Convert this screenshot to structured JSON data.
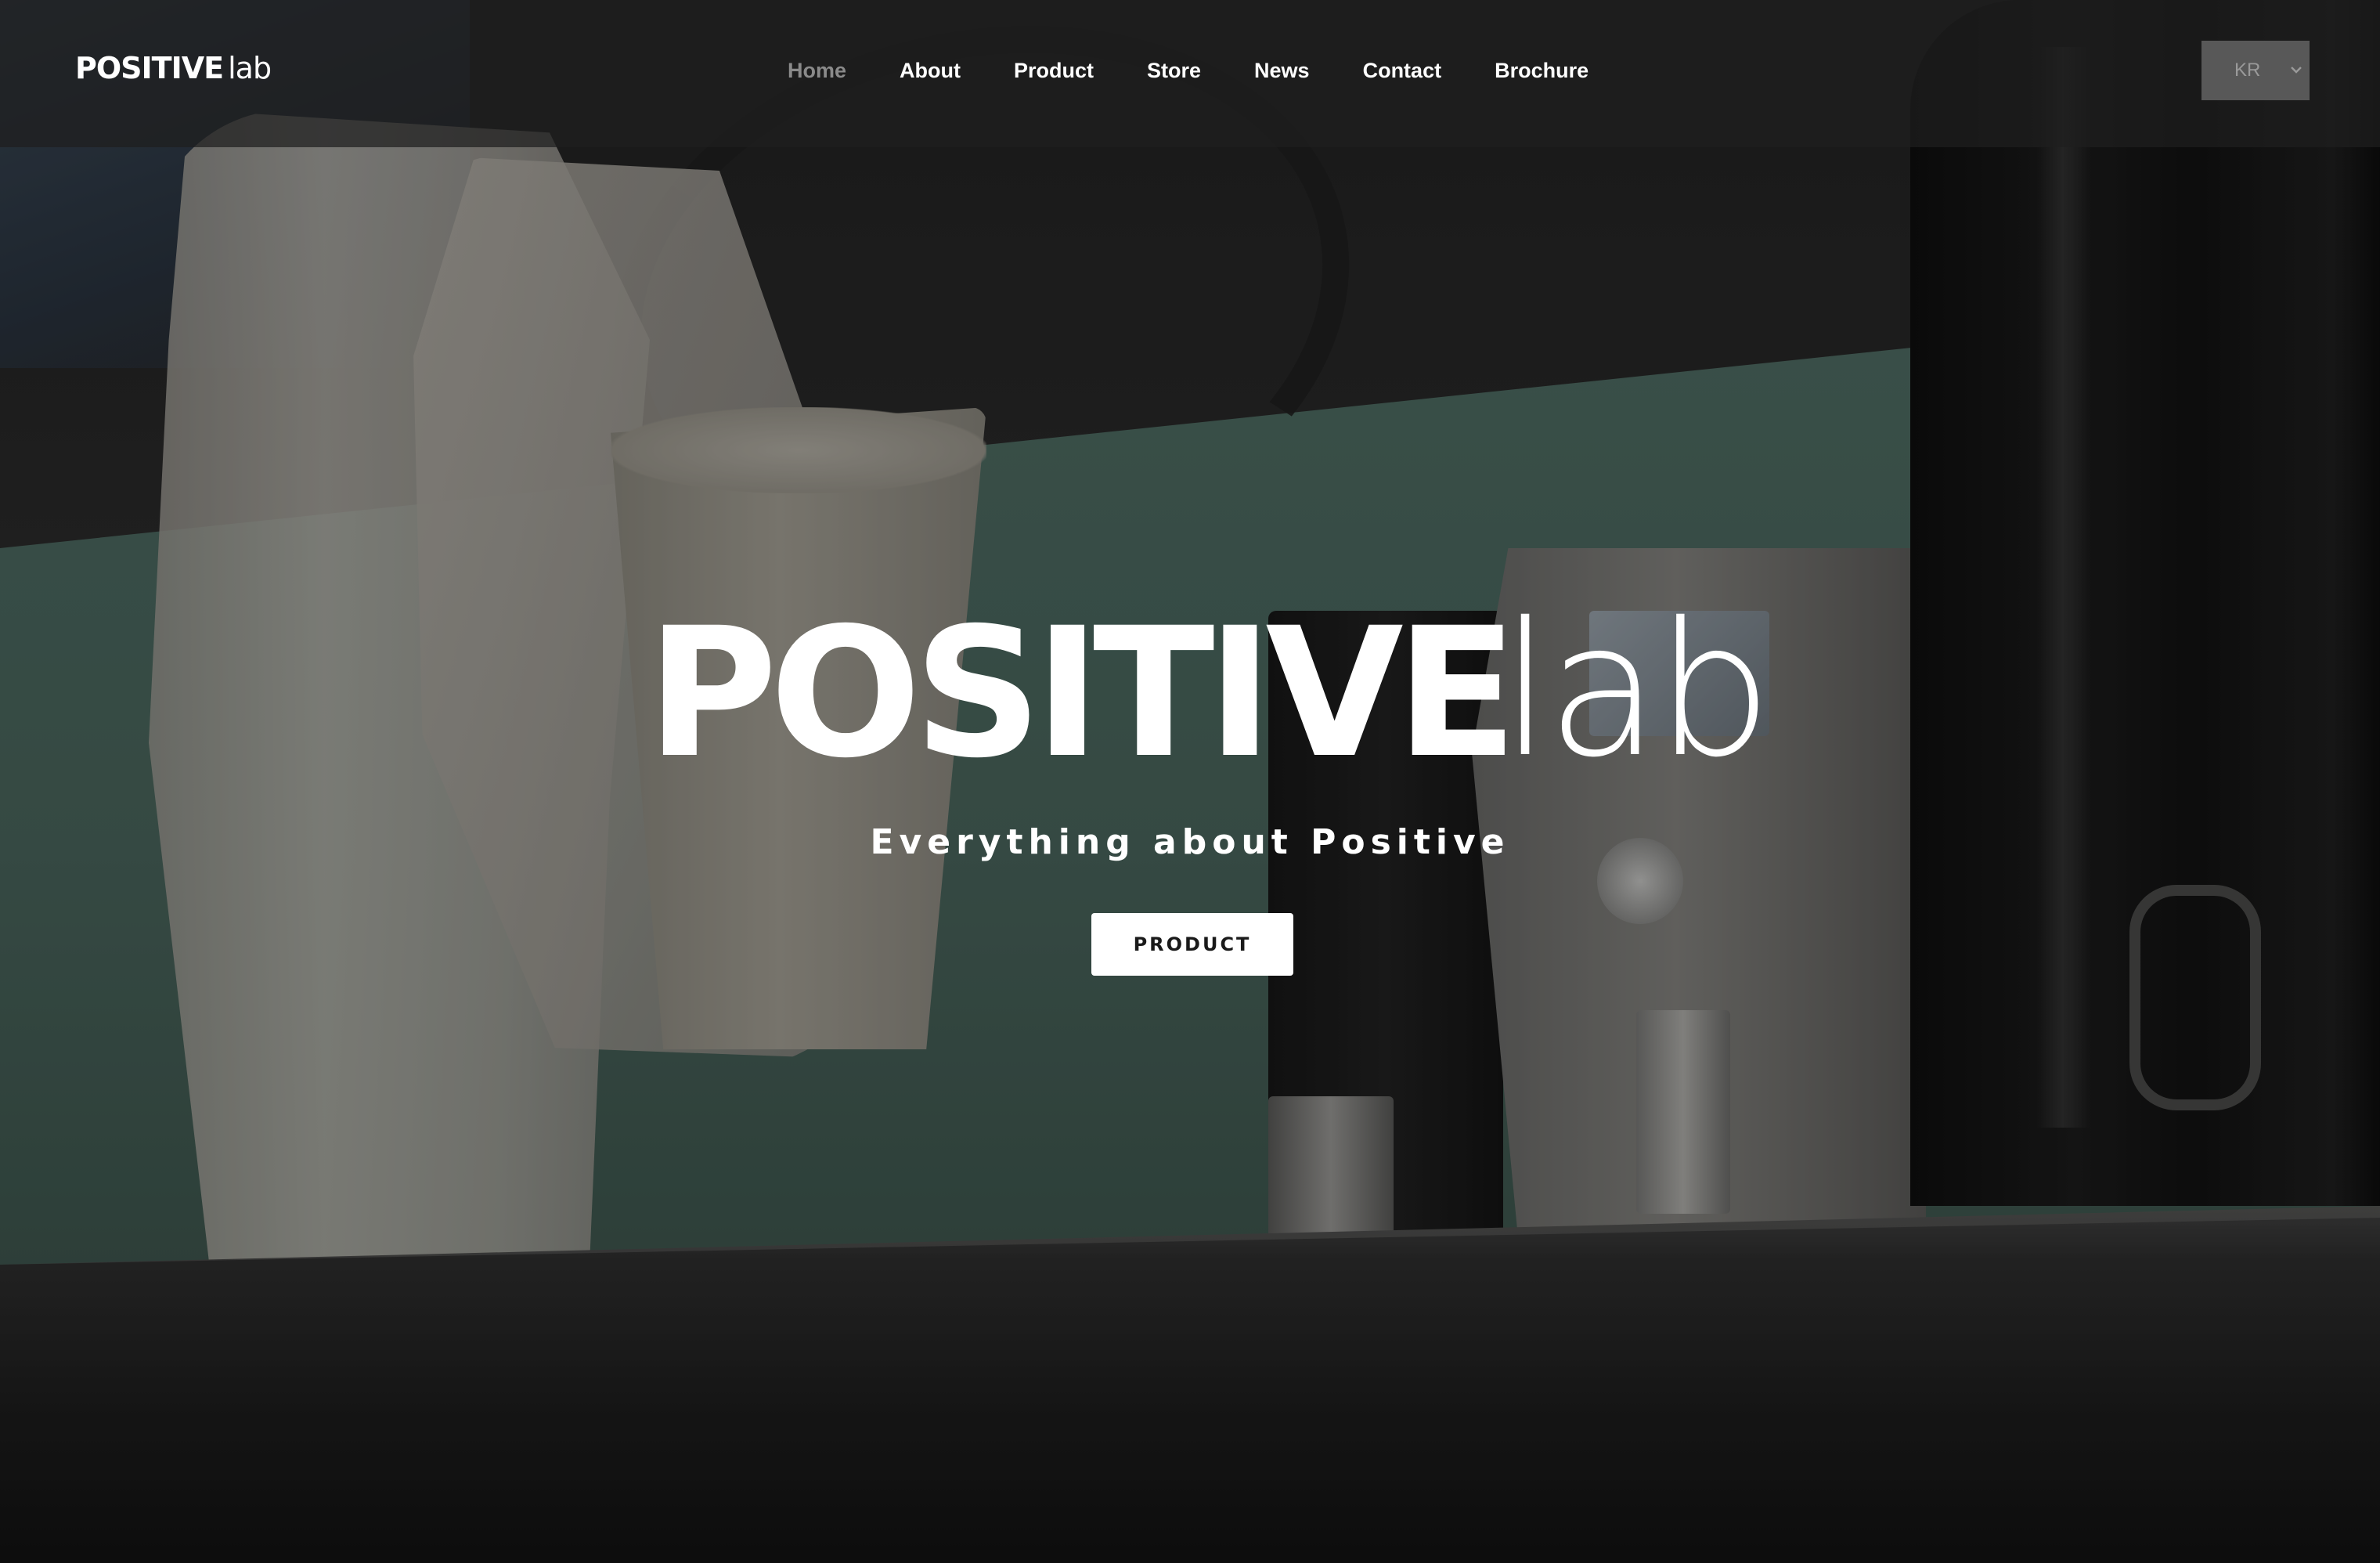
{
  "header": {
    "logo": {
      "bold": "POSITIVE",
      "light": "lab"
    },
    "nav": [
      {
        "label": "Home",
        "active": true
      },
      {
        "label": "About"
      },
      {
        "label": "Product"
      },
      {
        "label": "Store"
      },
      {
        "label": "News"
      },
      {
        "label": "Contact"
      },
      {
        "label": "Brochure"
      }
    ],
    "language": {
      "selected": "KR",
      "icon": "chevron-down-icon"
    }
  },
  "hero": {
    "logo": {
      "bold": "POSITIVE",
      "light": "lab"
    },
    "tagline": "Everything about Positive",
    "cta_label": "PRODUCT"
  },
  "colors": {
    "text": "#ffffff",
    "nav_active": "#8a8a8a",
    "header_bg": "#1e1e1e",
    "button_bg": "#ffffff",
    "button_text": "#1a1a1a"
  }
}
